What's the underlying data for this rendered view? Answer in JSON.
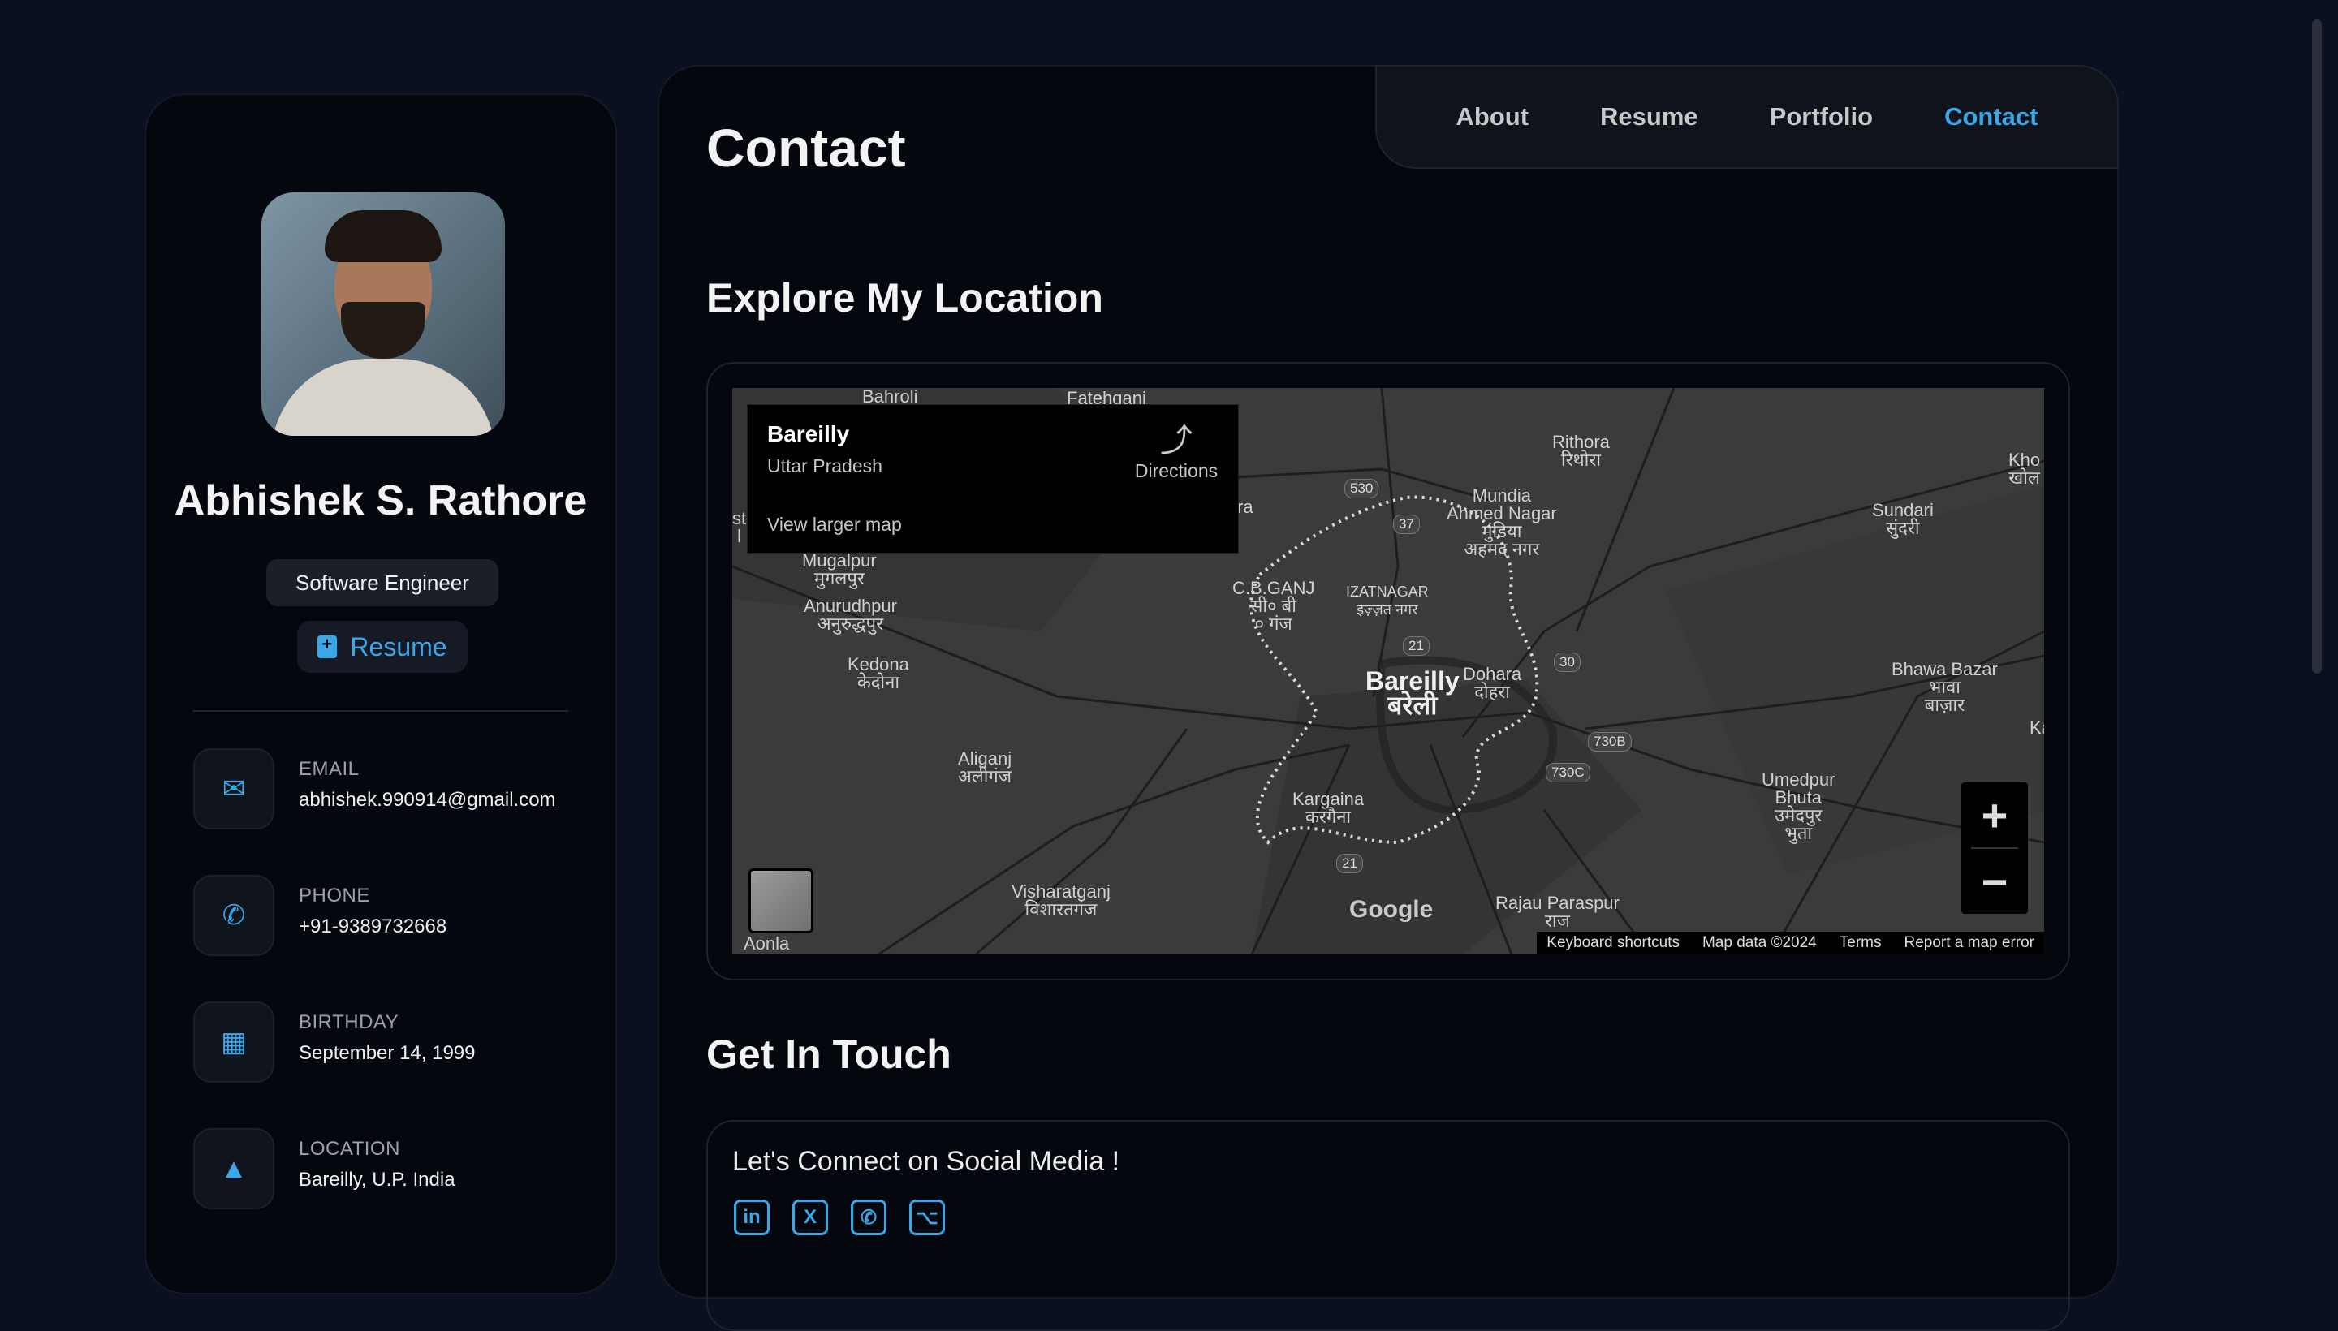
{
  "profile": {
    "name": "Abhishek S. Rathore",
    "title": "Software Engineer",
    "resume_label": "Resume"
  },
  "contacts": [
    {
      "label": "EMAIL",
      "value": "abhishek.990914@gmail.com",
      "icon": "mail-icon"
    },
    {
      "label": "PHONE",
      "value": "+91-9389732668",
      "icon": "phone-icon"
    },
    {
      "label": "BIRTHDAY",
      "value": "September 14, 1999",
      "icon": "calendar-icon"
    },
    {
      "label": "LOCATION",
      "value": "Bareilly, U.P. India",
      "icon": "location-icon"
    }
  ],
  "nav": [
    "About",
    "Resume",
    "Portfolio",
    "Contact"
  ],
  "nav_active": "Contact",
  "page_title": "Contact",
  "sections": {
    "location": "Explore My Location",
    "touch": "Get In Touch"
  },
  "map": {
    "place_name": "Bareilly",
    "place_region": "Uttar Pradesh",
    "directions": "Directions",
    "larger_map": "View larger map",
    "attribution": [
      "Keyboard shortcuts",
      "Map data ©2024",
      "Terms",
      "Report a map error"
    ],
    "logo": "Google",
    "zoom_in": "+",
    "zoom_out": "−",
    "labels": {
      "bahroli": "Bahroli",
      "fatehganj": "Fatehganj",
      "rithora": "Rithora\nरिथोरा",
      "mundia": "Mundia\nAhmed Nagar\nमुंडिया\nअहमद नगर",
      "kho": "Kho\nखोल",
      "sundari": "Sundari\nसुंदरी",
      "mugalpur": "Mugalpur\nमुगलपुर",
      "anurudhpur": "Anurudhpur\nअनुरुद्धपुर",
      "cbganj": "C.B.GANJ\nसी० बी\n० गंज",
      "izatnagar": "IZATNAGAR\nइज़्ज़त नगर",
      "kedona": "Kedona\nकेदोना",
      "bareilly": "Bareilly\nबरेली",
      "dohara": "Dohara\nदोहरा",
      "bhawa": "Bhawa Bazar\nभावा\nबाज़ार",
      "ka": "Ka",
      "aliganj": "Aliganj\nअलीगंज",
      "umedpur": "Umedpur\nBhuta\nउमेदपुर\nभुता",
      "kargaina": "Kargaina\nकरगैना",
      "visharatganj": "Visharatganj\nविशारतगंज",
      "rajau": "Rajau Paraspur\nराज",
      "aonla": "Aonla",
      "st": "st\nl",
      "ra": "ra"
    },
    "shields": {
      "s530": "530",
      "s37": "37",
      "s21a": "21",
      "s30": "30",
      "s730b": "730B",
      "s730c": "730C",
      "s21b": "21"
    }
  },
  "touch": {
    "heading": "Let's Connect on Social Media !"
  },
  "socials": [
    {
      "name": "linkedin",
      "glyph": "in"
    },
    {
      "name": "x",
      "glyph": "X"
    },
    {
      "name": "whatsapp",
      "glyph": "✆"
    },
    {
      "name": "github",
      "glyph": "⌥"
    }
  ],
  "colors": {
    "accent": "#3aa8e8",
    "background": "#0b1020",
    "card": "#05070f"
  }
}
